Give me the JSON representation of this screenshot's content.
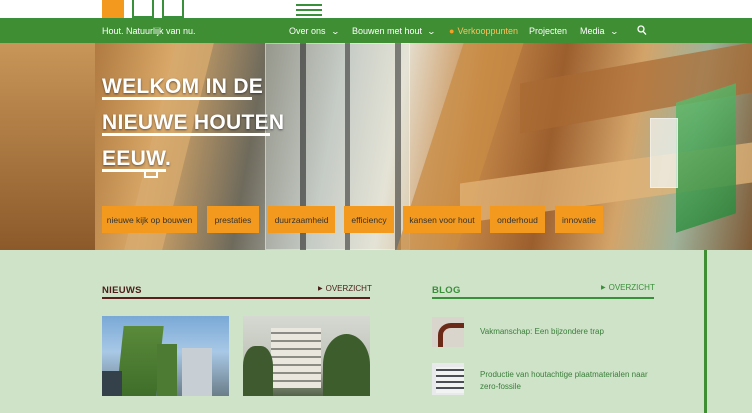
{
  "header": {
    "tagline": "Hout. Natuurlijk van nu.",
    "nav": [
      {
        "label": "Over ons",
        "has_dropdown": true
      },
      {
        "label": "Bouwen met hout",
        "has_dropdown": true
      },
      {
        "label": "Verkooppunten",
        "active": true,
        "icon": "map-pin-icon"
      },
      {
        "label": "Projecten",
        "has_dropdown": false
      },
      {
        "label": "Media",
        "has_dropdown": true
      }
    ],
    "search_icon": "search-icon"
  },
  "hero": {
    "title_lines": [
      "WELKOM IN DE",
      "NIEUWE HOUTEN",
      "EEUW."
    ],
    "buttons": [
      "nieuwe kijk op bouwen",
      "prestaties",
      "duurzaamheid",
      "efficiency",
      "kansen voor hout",
      "onderhoud",
      "innovatie"
    ]
  },
  "news": {
    "title": "NIEUWS",
    "overview_label": "OVERZICHT"
  },
  "blog": {
    "title": "BLOG",
    "overview_label": "OVERZICHT",
    "items": [
      {
        "title": "Vakmanschap: Een bijzondere trap"
      },
      {
        "title": "Productie van houtachtige plaatmaterialen naar zero-fossile"
      }
    ]
  },
  "colors": {
    "nav_green": "#3f8e34",
    "accent_orange": "#f39a1e",
    "news_brown": "#5a1f1a",
    "page_bg": "#cfe3c9"
  }
}
